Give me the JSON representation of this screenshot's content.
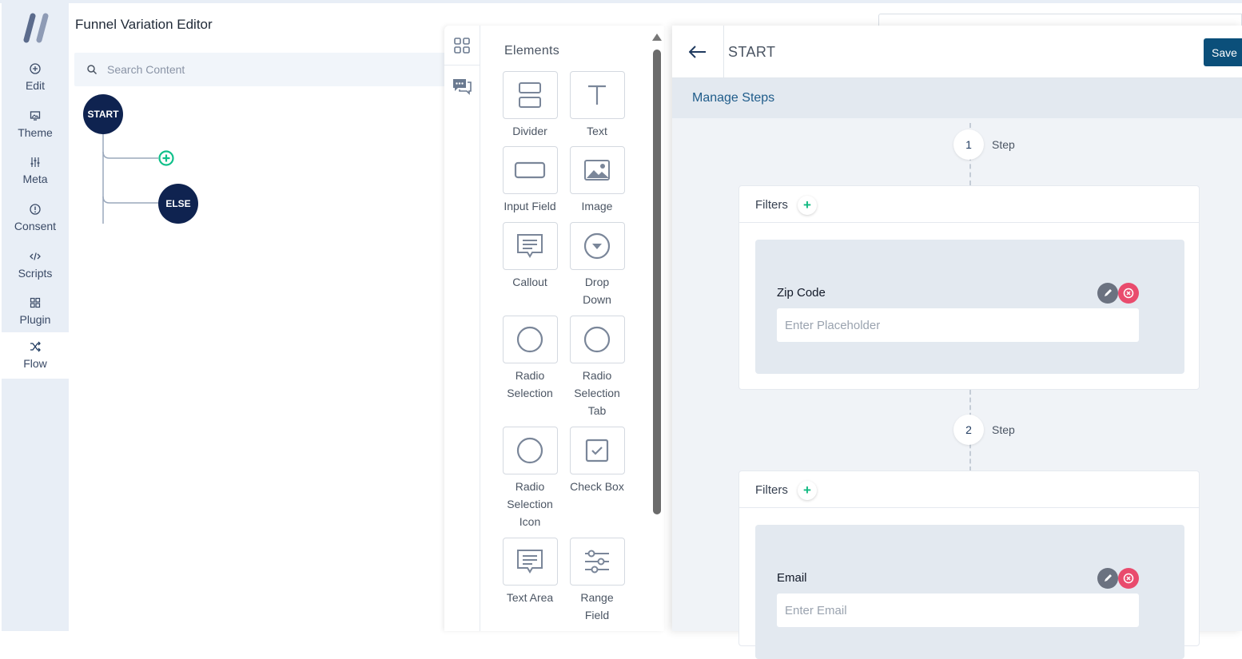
{
  "app": {
    "title": "Funnel Variation Editor",
    "logo_icon": "logo-slashes-icon"
  },
  "nav": {
    "items": [
      {
        "label": "Edit",
        "icon": "plus-circle-icon"
      },
      {
        "label": "Theme",
        "icon": "theme-icon"
      },
      {
        "label": "Meta",
        "icon": "sliders-icon"
      },
      {
        "label": "Consent",
        "icon": "info-circle-icon"
      },
      {
        "label": "Scripts",
        "icon": "code-icon"
      },
      {
        "label": "Plugin",
        "icon": "grid-icon"
      },
      {
        "label": "Flow",
        "icon": "shuffle-icon"
      }
    ],
    "active": "Flow"
  },
  "search": {
    "placeholder": "Search Content",
    "value": ""
  },
  "flow": {
    "start_label": "START",
    "else_label": "ELSE"
  },
  "elements_panel": {
    "title": "Elements",
    "tab_icons": [
      "apps-grid-icon",
      "chat-bubble-icon"
    ],
    "items": [
      {
        "label": "Divider",
        "icon": "divider-icon"
      },
      {
        "label": "Text",
        "icon": "text-icon"
      },
      {
        "label": "Input Field",
        "icon": "input-field-icon"
      },
      {
        "label": "Image",
        "icon": "image-icon"
      },
      {
        "label": "Callout",
        "icon": "callout-icon"
      },
      {
        "label": "Drop Down",
        "icon": "dropdown-icon"
      },
      {
        "label": "Radio Selection",
        "icon": "radio-icon"
      },
      {
        "label": "Radio Selection Tab",
        "icon": "radio-icon"
      },
      {
        "label": "Radio Selection Icon",
        "icon": "radio-icon"
      },
      {
        "label": "Check Box",
        "icon": "checkbox-icon"
      },
      {
        "label": "Text Area",
        "icon": "textarea-icon"
      },
      {
        "label": "Range Field",
        "icon": "range-icon"
      }
    ]
  },
  "step_panel": {
    "title": "START",
    "save_label": "Save",
    "manage_steps_label": "Manage Steps",
    "steps": [
      {
        "number": "1",
        "word": "Step",
        "filters_label": "Filters",
        "filter_add": "+",
        "field_label": "Zip Code",
        "field_placeholder": "Enter Placeholder"
      },
      {
        "number": "2",
        "word": "Step",
        "filters_label": "Filters",
        "filter_add": "+",
        "field_label": "Email",
        "field_placeholder": "Enter Email"
      }
    ]
  },
  "colors": {
    "nav_bg": "#e8eef6",
    "node_bg": "#0f2350",
    "save_bg": "#0b4f7a",
    "accent_green": "#10b981",
    "delete_red": "#e94b6d"
  }
}
